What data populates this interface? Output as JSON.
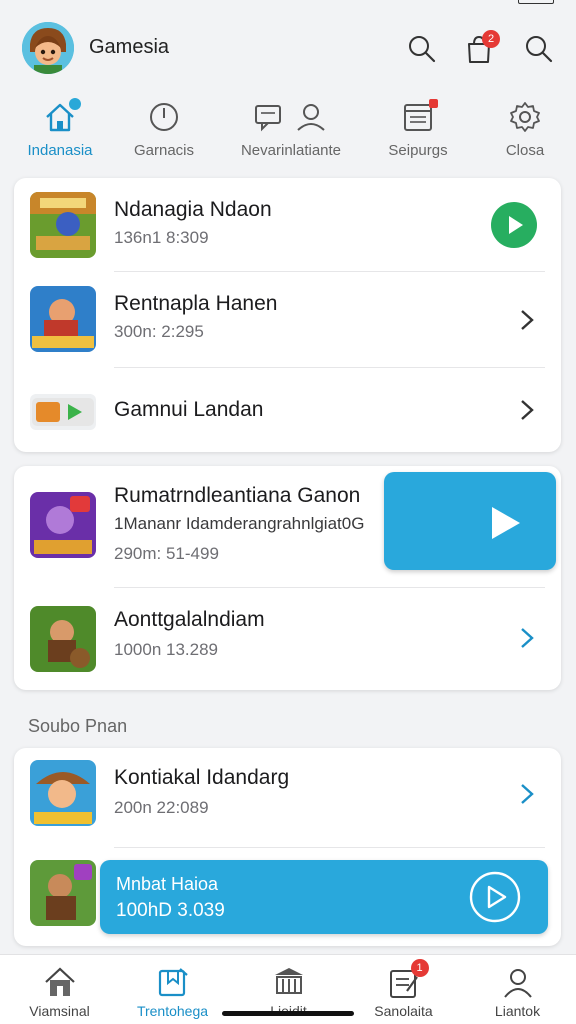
{
  "app": {
    "title": "Gamesia"
  },
  "header": {
    "notification_count": "2"
  },
  "tabs": [
    {
      "label": "Indanasia",
      "icon": "home-icon",
      "active": true
    },
    {
      "label": "Garnacis",
      "icon": "clock-icon"
    },
    {
      "label": "Nevarinlatiante",
      "icon": "chat-icon"
    },
    {
      "label": "Seipurgs",
      "icon": "news-icon"
    },
    {
      "label": "Closa",
      "icon": "gear-icon"
    }
  ],
  "group1": [
    {
      "title": "Ndanagia Ndaon",
      "subtitle": "136n1 8:309",
      "action": "play"
    },
    {
      "title": "Rentnapla Hanen",
      "subtitle": "300n: 2:295",
      "action": "chevron"
    },
    {
      "title": "Gamnui Landan",
      "action": "chevron"
    }
  ],
  "group2": [
    {
      "title": "Rumatrndleantiana Ganon",
      "subtitle": "1Mananr Idamderangrahnlgiat0G",
      "meta": "290m: 51-499",
      "action": "play-large"
    },
    {
      "title": "Aonttgalalndiam",
      "subtitle": "1000n 13.289",
      "action": "chevron"
    }
  ],
  "section_label": "Soubo Pnan",
  "group3": [
    {
      "title": "Kontiakal Idandarg",
      "subtitle": "200n 22:089",
      "action": "chevron"
    },
    {
      "title": "Mnbat Haioa",
      "subtitle": "100hD 3.039",
      "action": "play-banner"
    }
  ],
  "bottom_nav": [
    {
      "label": "Viamsinal",
      "icon": "house-icon"
    },
    {
      "label": "Trentohega",
      "icon": "bookmark-icon",
      "active": true
    },
    {
      "label": "Lieidit",
      "icon": "library-icon"
    },
    {
      "label": "Sanolaita",
      "icon": "notepad-icon",
      "badge": "1"
    },
    {
      "label": "Liantok",
      "icon": "user-icon"
    }
  ],
  "colors": {
    "accent": "#1a8fc7",
    "banner_blue": "#29a8dc",
    "play_green": "#27ae60",
    "badge_red": "#e53935"
  }
}
